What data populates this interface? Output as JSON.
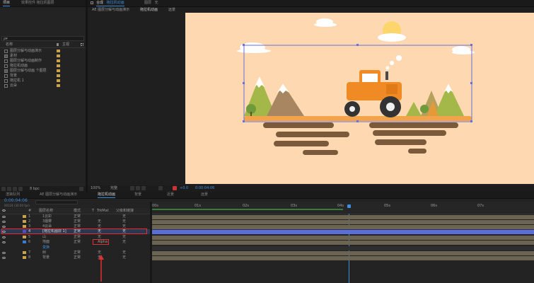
{
  "top_panel": {
    "tabs": [
      {
        "label": "项目"
      },
      {
        "label": "效果控件 拖拉机图层"
      }
    ]
  },
  "project": {
    "search_placeholder": "ρ▾",
    "col_name": "名称",
    "col_type": "类型",
    "col_type2": "主视",
    "items": [
      {
        "name": "图层分解与动画演示",
        "color": "#c9a24a"
      },
      {
        "name": "素材",
        "color": "#c9a24a"
      },
      {
        "name": "图层分解与动画制作",
        "color": "#c9a24a"
      },
      {
        "name": "拖拉机动画",
        "color": "#c9a24a"
      },
      {
        "name": "图层分解与动画 个图层",
        "color": "#c9a24a"
      },
      {
        "name": "背景",
        "color": "#c9a24a"
      },
      {
        "name": "拖拉机 1",
        "color": "#c9a24a"
      },
      {
        "name": "云朵",
        "color": "#c9a24a"
      }
    ],
    "bpc": "8 bpc"
  },
  "comp_panel": {
    "breadcrumb1": "合成",
    "breadcrumb2": "拖拉机动画",
    "breadcrumb3": "图层",
    "breadcrumb4": "无",
    "subtab1": "AE 图层分解与动画演示",
    "subtab2": "拖拉机动画",
    "subtab3": "远景",
    "zoom": "100%",
    "quality": "完整",
    "timecode": "0:00:04:06",
    "offset": "+0.0"
  },
  "timeline": {
    "tabs": [
      {
        "label": "渲染队列"
      },
      {
        "label": "AE 图层分解与动画演示"
      },
      {
        "label": "拖拉机动画"
      },
      {
        "label": "背景"
      },
      {
        "label": "近景"
      },
      {
        "label": "远景"
      }
    ],
    "timecode": "0:00:04:06",
    "frame_info": "00124 (30.00 fps)",
    "col_num": "#",
    "col_layer_name": "图层名称",
    "col_mode": "模式",
    "col_t": "T",
    "col_trkmat": "TrkMat",
    "col_parent": "父级和链接",
    "ticks": [
      "00s",
      "01s",
      "02s",
      "03s",
      "04s",
      "05s",
      "06s",
      "07s"
    ],
    "layers": [
      {
        "num": "1",
        "name": "1云彩",
        "mode": "正常",
        "trkmat": "",
        "parent": "无",
        "color": "#c9a24a"
      },
      {
        "num": "2",
        "name": "3烟雾",
        "mode": "正常",
        "trkmat": "无",
        "parent": "无",
        "color": "#c9a24a"
      },
      {
        "num": "3",
        "name": "4云朵",
        "mode": "正常",
        "trkmat": "无",
        "parent": "无",
        "color": "#c9a24a"
      },
      {
        "num": "4",
        "name": "[拖拉机图层 1]",
        "mode": "正常",
        "trkmat": "无",
        "parent": "无",
        "color": "#5a4ad0"
      },
      {
        "num": "5",
        "name": "山",
        "mode": "正常",
        "trkmat": "无",
        "parent": "无",
        "color": "#c9a24a"
      },
      {
        "num": "6",
        "name": "地面",
        "mode": "正常",
        "trkmat": "Alpha",
        "parent": "无",
        "color": "#3a7bd5"
      },
      {
        "num": "",
        "name": "变换",
        "mode": "",
        "trkmat": "",
        "parent": "",
        "color": "#3a7bd5"
      },
      {
        "num": "7",
        "name": "树",
        "mode": "正常",
        "trkmat": "无",
        "parent": "无",
        "color": "#c9a24a"
      },
      {
        "num": "8",
        "name": "背景",
        "mode": "正常",
        "trkmat": "无",
        "parent": "无",
        "color": "#c9a24a"
      }
    ],
    "playhead_time": "04s"
  },
  "colors": {
    "accent": "#3d8fe0",
    "canvas_bg": "#fed8b1",
    "selected_track": "#5a6fd8",
    "highlight_box": "#e03030"
  }
}
